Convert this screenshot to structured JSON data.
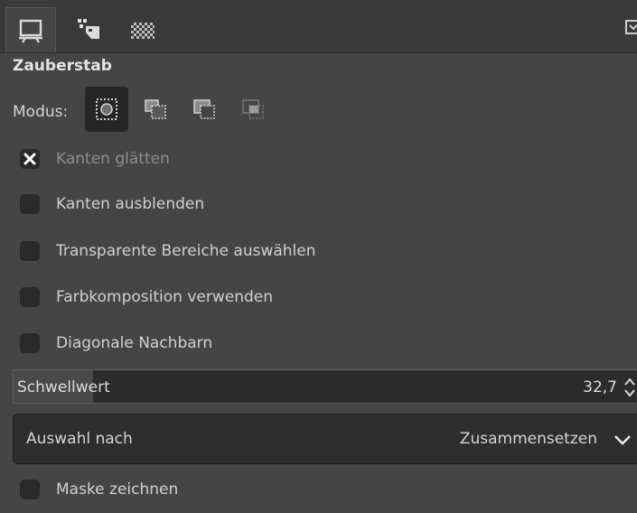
{
  "tabs": [
    {
      "icon": "tool-options-icon",
      "active": true
    },
    {
      "icon": "device-status-icon",
      "active": false
    },
    {
      "icon": "pattern-icon",
      "active": false
    }
  ],
  "panel": {
    "title": "Zauberstab",
    "mode_label": "Modus:",
    "modes": [
      "replace-mode-icon",
      "add-mode-icon",
      "subtract-mode-icon",
      "intersect-mode-icon"
    ],
    "active_mode": "replace-mode-icon"
  },
  "options": {
    "antialias": {
      "label": "Kanten glätten",
      "checked": true
    },
    "feather": {
      "label": "Kanten ausblenden",
      "checked": false
    },
    "transparent": {
      "label": "Transparente Bereiche auswählen",
      "checked": false
    },
    "sample_merged": {
      "label": "Farbkomposition verwenden",
      "checked": false
    },
    "diagonal": {
      "label": "Diagonale Nachbarn",
      "checked": false
    },
    "draw_mask": {
      "label": "Maske zeichnen",
      "checked": false
    }
  },
  "threshold": {
    "label": "Schwellwert",
    "value": "32,7",
    "fraction": 0.128
  },
  "select_by": {
    "label": "Auswahl nach",
    "value": "Zusammensetzen"
  },
  "colors": {
    "background": "#454545",
    "tabbar": "#3a3a3a",
    "field": "#2c2c2c",
    "text": "#dcdcdc"
  }
}
